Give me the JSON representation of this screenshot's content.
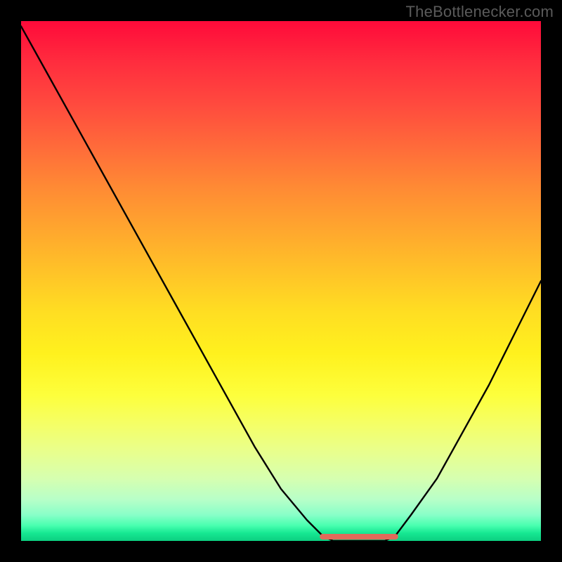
{
  "watermark": "TheBottlenecker.com",
  "chart_data": {
    "type": "line",
    "title": "",
    "xlabel": "",
    "ylabel": "",
    "xlim": [
      0,
      100
    ],
    "ylim": [
      0,
      100
    ],
    "background": "rainbow-vertical",
    "x": [
      0,
      5,
      10,
      15,
      20,
      25,
      30,
      35,
      40,
      45,
      50,
      55,
      58,
      60,
      63,
      66,
      70,
      72,
      75,
      80,
      85,
      90,
      95,
      100
    ],
    "values": [
      99,
      90,
      81,
      72,
      63,
      54,
      45,
      36,
      27,
      18,
      10,
      4,
      1,
      0,
      0,
      0,
      0,
      1,
      5,
      12,
      21,
      30,
      40,
      50
    ],
    "annotations": [
      {
        "type": "flat-zone",
        "x_start": 58,
        "x_end": 72,
        "color": "#e26a5a",
        "stroke_width": 8
      }
    ],
    "grid": false,
    "legend": null
  }
}
